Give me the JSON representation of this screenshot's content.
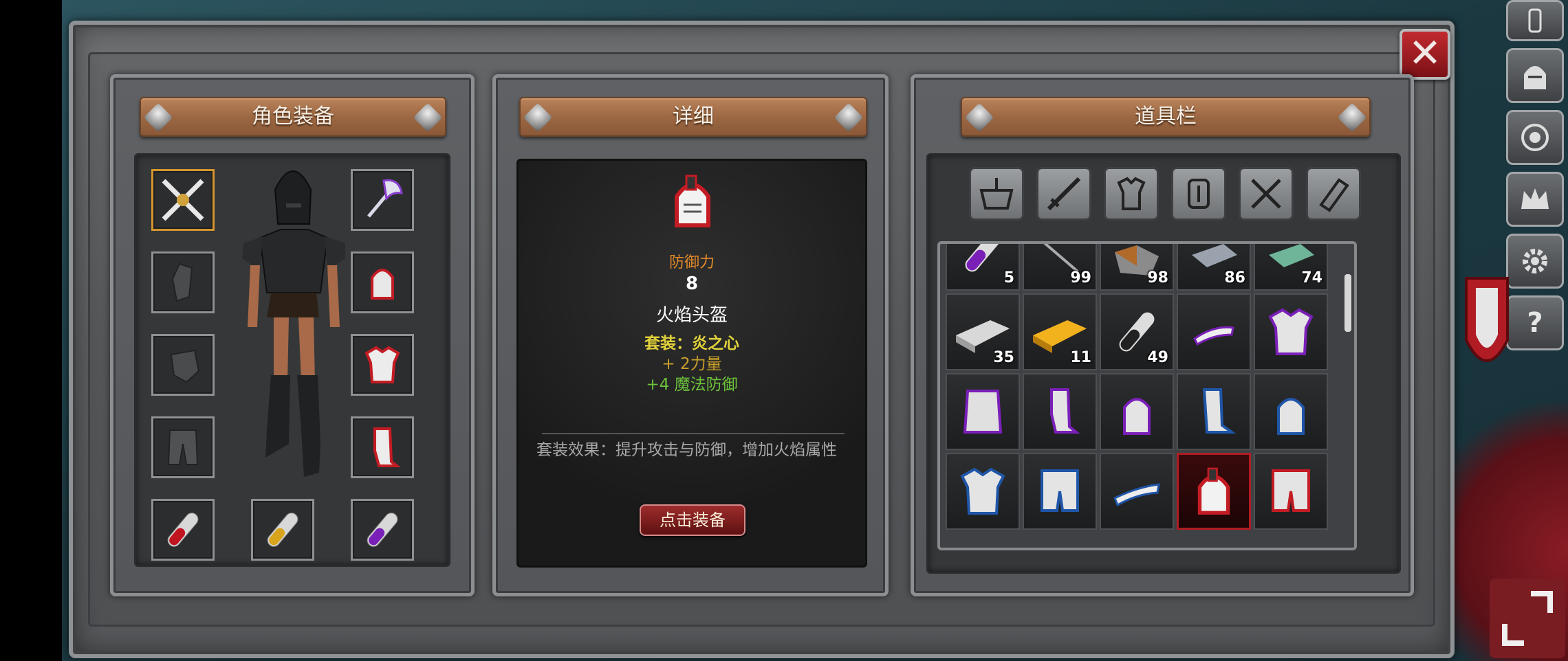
{
  "panels": {
    "equipment": {
      "title": "角色装备"
    },
    "detail": {
      "title": "详细",
      "stat_label": "防御力",
      "stat_value": "8",
      "item_name": "火焰头盔",
      "set_line": "套装：炎之心",
      "bonus_strength": "+ 2力量",
      "bonus_magic_def": "+4 魔法防御",
      "set_effect": "套装效果：提升攻击与防御，增加火焰属性",
      "equip_button": "点击装备"
    },
    "inventory": {
      "title": "道具栏",
      "row1_counts": [
        "5",
        "99",
        "98",
        "86",
        "74"
      ],
      "row2_counts": [
        "35",
        "11",
        "49",
        "",
        ""
      ]
    }
  },
  "colors": {
    "stat_label": "#e08a2a",
    "set_line": "#e2d23a",
    "bonus_strength": "#c9a02a",
    "bonus_magic_def": "#6cc23a",
    "selected_border": "#b01c22"
  },
  "icons": {
    "equipment_slots": [
      "crossed-swords-icon",
      "battle-axe-icon",
      "armor-piece-icon",
      "helmet-icon",
      "glove-icon",
      "chest-armor-icon",
      "pants-icon",
      "leg-armor-icon",
      "red-potion-icon",
      "yellow-potion-icon",
      "purple-potion-icon"
    ],
    "inventory_tabs": [
      "basket-icon",
      "weapon-icon",
      "armor-icon",
      "accessory-icon",
      "tools-icon",
      "scroll-icon"
    ],
    "side_menu": [
      "character-icon",
      "helmet-icon",
      "skill-icon",
      "crown-icon",
      "gear-icon",
      "help-icon"
    ]
  },
  "side_menu": {
    "help_label": "?"
  }
}
